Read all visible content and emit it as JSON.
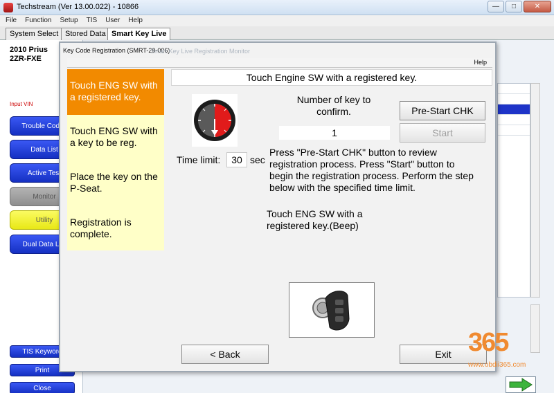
{
  "window": {
    "title": "Techstream (Ver 13.00.022) - 10866",
    "controls": [
      "minimize",
      "maximize",
      "close"
    ]
  },
  "menu": [
    "File",
    "Function",
    "Setup",
    "TIS",
    "User",
    "Help"
  ],
  "tabs": [
    {
      "label": "System Select",
      "active": false
    },
    {
      "label": "Stored Data",
      "active": false
    },
    {
      "label": "Smart Key Live",
      "active": true
    }
  ],
  "vehicle": {
    "model": "2010 Prius",
    "engine": "2ZR-FXE"
  },
  "sidebar": {
    "input_vin": "Input VIN",
    "items": [
      {
        "label": "Trouble Codes",
        "style": "blue"
      },
      {
        "label": "Data List",
        "style": "blue"
      },
      {
        "label": "Active Test",
        "style": "blue"
      },
      {
        "label": "Monitor",
        "style": "grey"
      },
      {
        "label": "Utility",
        "style": "yellow"
      },
      {
        "label": "Dual Data List",
        "style": "blue"
      }
    ],
    "bottom": [
      {
        "label": "TIS Keyword"
      },
      {
        "label": "Print"
      },
      {
        "label": "Close"
      }
    ]
  },
  "dialog": {
    "title": "Key Code Registration (SMRT-29-006)",
    "ghost_title": "Smart Key Live   Registration   Monitor",
    "help": "Help",
    "header": "Touch Engine SW with a registered key.",
    "steps": [
      {
        "label": "Touch ENG SW with a registered key.",
        "active": true
      },
      {
        "label": "Touch ENG SW with a key to be reg.",
        "active": false
      },
      {
        "label": "Place the key on the P-Seat.",
        "active": false
      },
      {
        "label": "Registration is complete.",
        "active": false
      }
    ],
    "time_limit_label": "Time limit:",
    "time_limit_value": "30",
    "time_unit": "sec",
    "num_key_label": "Number of key to confirm.",
    "num_key_value": "1",
    "prestart_button": "Pre-Start CHK",
    "start_button": "Start",
    "instructions": "Press \"Pre-Start CHK\" button to review registration process. Press \"Start\" button to begin the registration process. Perform the step below with the specified time limit.",
    "substep": "Touch ENG SW with a registered key.(Beep)",
    "back_button": "< Back",
    "exit_button": "Exit"
  },
  "watermark": {
    "digits": "365",
    "url": "www.obdii365.com"
  },
  "colors": {
    "active_step": "#f28a00",
    "step_bg": "#ffffc8",
    "nav_blue": "#1e36d6",
    "gauge_red": "#e11b1b"
  }
}
